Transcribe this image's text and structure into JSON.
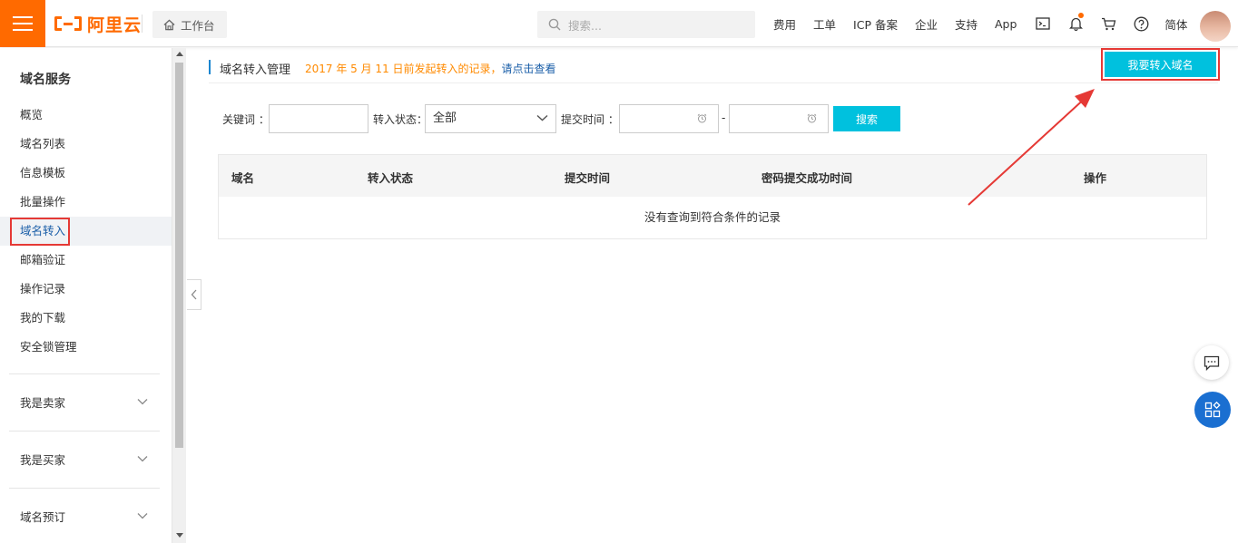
{
  "topbar": {
    "logo_text": "阿里云",
    "workbench_label": "工作台",
    "search_placeholder": "搜索...",
    "nav": [
      "费用",
      "工单",
      "ICP 备案",
      "企业",
      "支持",
      "App"
    ],
    "language": "简体"
  },
  "sidebar": {
    "title": "域名服务",
    "items": [
      "概览",
      "域名列表",
      "信息模板",
      "批量操作",
      "域名转入",
      "邮箱验证",
      "操作记录",
      "我的下载",
      "安全锁管理"
    ],
    "active_item": "域名转入",
    "groups": [
      "我是卖家",
      "我是买家",
      "域名预订"
    ]
  },
  "main": {
    "page_title": "域名转入管理",
    "notice_text": "2017 年 5 月 11 日前发起转入的记录，",
    "notice_link": "请点击查看",
    "transfer_button": "我要转入域名",
    "filters": {
      "keyword_label": "关键词 ：",
      "status_label": "转入状态：",
      "status_value": "全部",
      "time_label": "提交时间 ：",
      "range_separator": "-",
      "search_button": "搜索"
    },
    "table": {
      "columns": [
        "域名",
        "转入状态",
        "提交时间",
        "密码提交成功时间",
        "操作"
      ],
      "empty_text": "没有查询到符合条件的记录"
    }
  },
  "colors": {
    "brand_orange": "#ff6a00",
    "accent_cyan": "#00c1de",
    "annotation_red": "#e53935",
    "link_blue": "#1a5ea8"
  }
}
